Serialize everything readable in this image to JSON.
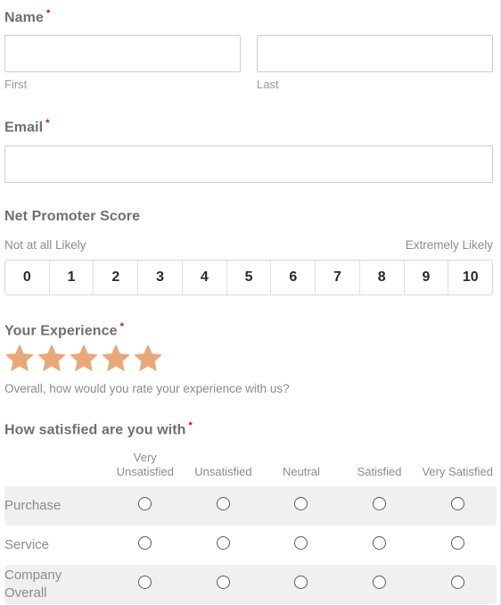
{
  "form": {
    "name": {
      "label": "Name",
      "required_mark": "*",
      "first_sublabel": "First",
      "last_sublabel": "Last",
      "first_value": "",
      "last_value": "",
      "first_placeholder": "",
      "last_placeholder": ""
    },
    "email": {
      "label": "Email",
      "required_mark": "*",
      "value": "",
      "placeholder": ""
    },
    "nps": {
      "label": "Net Promoter Score",
      "low_anchor": "Not at all Likely",
      "high_anchor": "Extremely Likely",
      "options": [
        "0",
        "1",
        "2",
        "3",
        "4",
        "5",
        "6",
        "7",
        "8",
        "9",
        "10"
      ],
      "selected": null
    },
    "experience": {
      "label": "Your Experience",
      "required_mark": "*",
      "help_text": "Overall, how would you rate your experience with us?",
      "star_count": 5,
      "stars_filled": 5,
      "star_color": "#e8a87c",
      "icon": "star-icon"
    },
    "satisfaction": {
      "label": "How satisfied are you with",
      "required_mark": "*",
      "columns": [
        "Very Unsatisfied",
        "Unsatisfied",
        "Neutral",
        "Satisfied",
        "Very Satisfied"
      ],
      "rows": [
        {
          "label": "Purchase",
          "selected": null
        },
        {
          "label": "Service",
          "selected": null
        },
        {
          "label": "Company Overall",
          "selected": null
        }
      ]
    }
  },
  "colors": {
    "label": "#6f6f6f",
    "muted_text": "#8c8c8c",
    "required": "#d0021b",
    "input_border": "#cccccc",
    "stripe": "#f0f0f0",
    "star": "#e8a87c"
  }
}
